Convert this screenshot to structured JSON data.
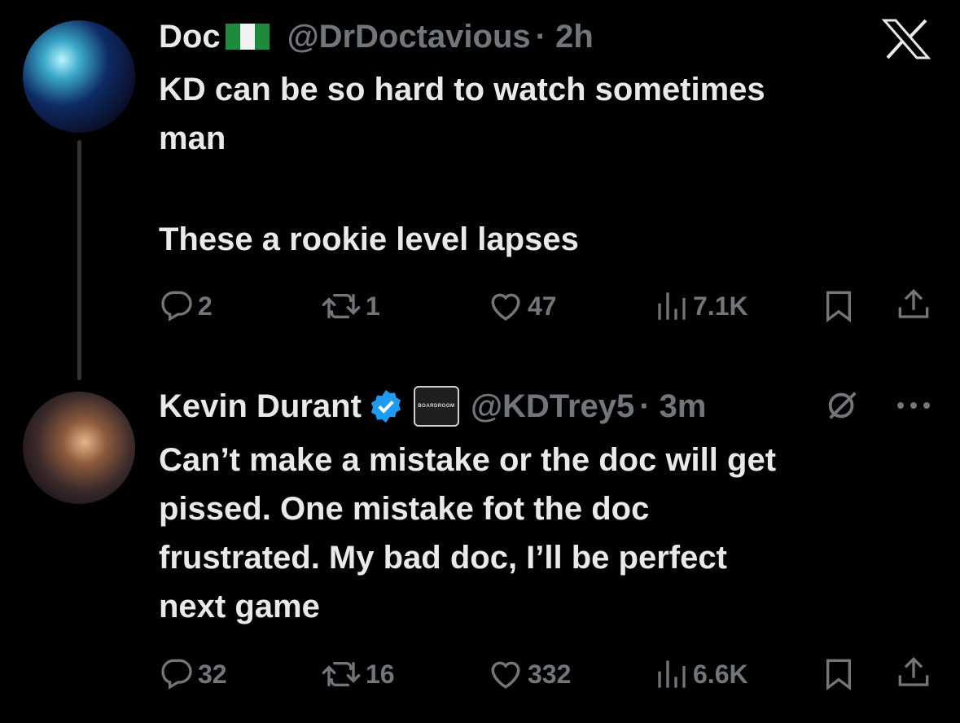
{
  "tweets": [
    {
      "name": "Doc",
      "handle": "@DrDoctavious",
      "time": "· 2h",
      "text_lines": [
        "KD can be so hard to watch sometimes",
        "man",
        "",
        "These a rookie level lapses"
      ],
      "stats": {
        "replies": "2",
        "retweets": "1",
        "likes": "47",
        "views": "7.1K"
      }
    },
    {
      "name": "Kevin Durant",
      "handle": "@KDTrey5",
      "time": "· 3m",
      "affiliate_badge_text": "BOARDROOM",
      "text_lines": [
        "Can’t make a mistake or the doc will get",
        "pissed. One mistake fot the doc",
        "frustrated. My bad doc, I’ll be perfect",
        "next game"
      ],
      "stats": {
        "replies": "32",
        "retweets": "16",
        "likes": "332",
        "views": "6.6K"
      }
    }
  ],
  "icons": {
    "close": "x-logo-icon",
    "reply": "reply-icon",
    "retweet": "retweet-icon",
    "like": "heart-icon",
    "views": "views-icon",
    "bookmark": "bookmark-icon",
    "share": "share-icon",
    "grok": "grok-icon",
    "more": "more-icon",
    "verified": "verified-badge-icon",
    "flag": "nigeria-flag-icon"
  },
  "colors": {
    "background": "#000000",
    "text": "#e7e9ea",
    "muted": "#71767b",
    "verified": "#1d9bf0"
  }
}
